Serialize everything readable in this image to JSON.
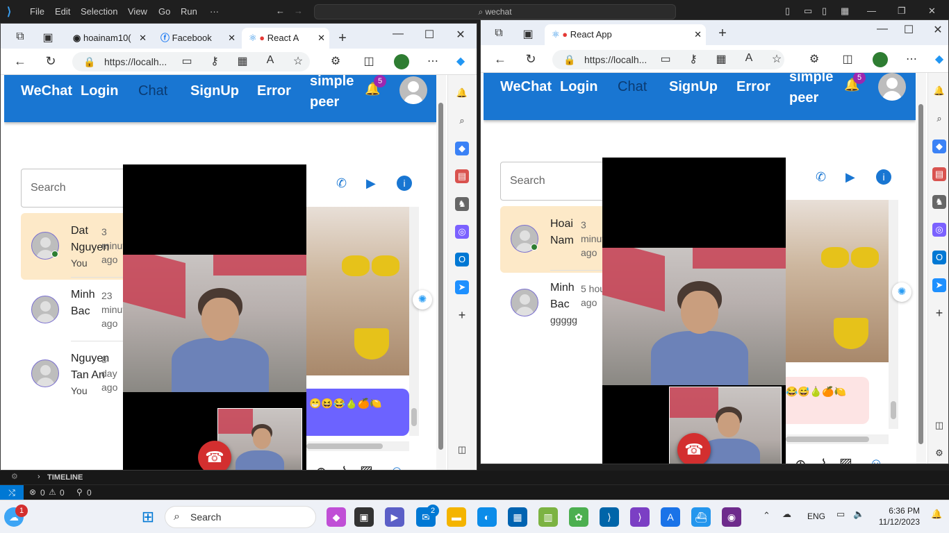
{
  "vscode": {
    "menu": [
      "File",
      "Edit",
      "Selection",
      "View",
      "Go",
      "Run"
    ],
    "more": "···",
    "search_text": "wechat",
    "panel_label": "TIMELINE",
    "status_errors": "0",
    "status_warnings": "0",
    "status_ports": "0"
  },
  "left_browser": {
    "tabs": [
      {
        "label": "hoainam10("
      },
      {
        "label": "Facebook"
      },
      {
        "label": "React A"
      }
    ],
    "url": "https://localh..."
  },
  "right_browser": {
    "tabs": [
      {
        "label": "React App"
      }
    ],
    "url": "https://localh..."
  },
  "app": {
    "nav": [
      "WeChat",
      "Login",
      "Chat",
      "SignUp",
      "Error"
    ],
    "simple_peer_line1": "simple",
    "simple_peer_line2": "peer",
    "notif_count": "5",
    "search_placeholder": "Search"
  },
  "left_conversations": [
    {
      "name1": "Dat",
      "name2": "Nguyen",
      "time1": "3",
      "time2": "minut",
      "time3": "ago",
      "msg": "You",
      "online": true
    },
    {
      "name1": "Minh",
      "name2": "Bac",
      "time1": "23",
      "time2": "minut",
      "time3": "ago",
      "msg": "",
      "online": false
    },
    {
      "name1": "Nguyen",
      "name2": "Tan An",
      "time1": "8",
      "time2": "day",
      "time3": "ago",
      "msg": "You",
      "online": false
    }
  ],
  "right_conversations": [
    {
      "name1": "Hoai",
      "name2": "Nam",
      "time1": "3",
      "time2": "minut",
      "time3": "ago",
      "msg": "",
      "online": true
    },
    {
      "name1": "Minh",
      "name2": "Bac",
      "time1": "5 hou",
      "time2": "ago",
      "time3": "",
      "msg": "ggggg",
      "online": false
    }
  ],
  "left_bubble": "😁😆😂🍐🍊🍋",
  "right_bubble": "😂😅🍐🍊🍋",
  "colors": {
    "appbar": "#1976d2",
    "active_conv": "#fde9c8",
    "bubble_self": "#6c63ff",
    "bubble_other": "#fde4e4",
    "hangup": "#d32f2f"
  },
  "taskbar": {
    "search_label": "Search",
    "mail_badge": "2",
    "edge_badge": "1",
    "lang": "ENG",
    "time": "6:36 PM",
    "date": "11/12/2023"
  }
}
